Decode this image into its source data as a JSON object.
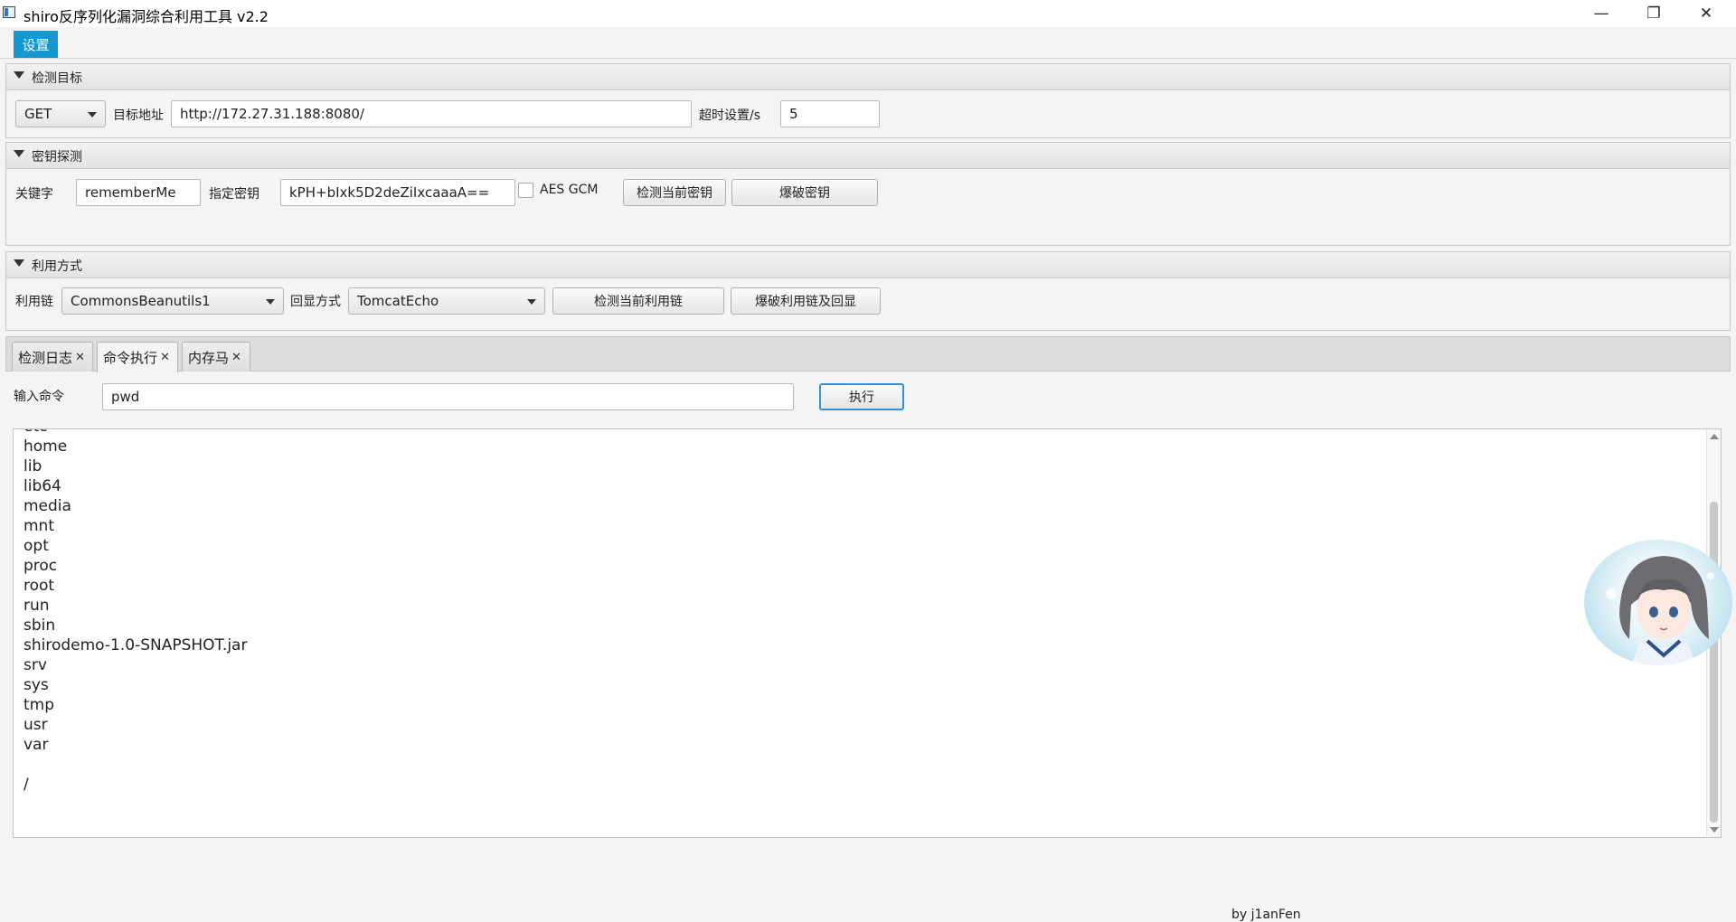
{
  "window": {
    "title": "shiro反序列化漏洞综合利用工具 v2.2",
    "minimize_glyph": "—",
    "maximize_glyph": "❐",
    "close_glyph": "✕"
  },
  "menu": {
    "settings": "设置"
  },
  "target_section": {
    "title": "检测目标",
    "method": "GET",
    "url_label": "目标地址",
    "url": "http://172.27.31.188:8080/",
    "timeout_label": "超时设置/s",
    "timeout": "5"
  },
  "key_section": {
    "title": "密钥探测",
    "keyword_label": "关键字",
    "keyword": "rememberMe",
    "key_label": "指定密钥",
    "key": "kPH+bIxk5D2deZiIxcaaaA==",
    "aes_gcm_label": "AES GCM",
    "check_key_button": "检测当前密钥",
    "brute_key_button": "爆破密钥"
  },
  "exploit_section": {
    "title": "利用方式",
    "chain_label": "利用链",
    "chain": "CommonsBeanutils1",
    "echo_label": "回显方式",
    "echo": "TomcatEcho",
    "check_chain_button": "检测当前利用链",
    "brute_chain_button": "爆破利用链及回显"
  },
  "tabs": [
    {
      "label": "检测日志",
      "close": "✕"
    },
    {
      "label": "命令执行",
      "close": "✕"
    },
    {
      "label": "内存马",
      "close": "✕"
    }
  ],
  "command": {
    "label": "输入命令",
    "value": "pwd",
    "execute_button": "执行"
  },
  "output": {
    "text": "etc\nhome\nlib\nlib64\nmedia\nmnt\nopt\nproc\nroot\nrun\nsbin\nshirodemo-1.0-SNAPSHOT.jar\nsrv\nsys\ntmp\nusr\nvar\n\n/"
  },
  "footer": {
    "text": "by   j1anFen"
  },
  "colors": {
    "accent": "#1597d0",
    "execute_border": "#3a8fd4"
  }
}
